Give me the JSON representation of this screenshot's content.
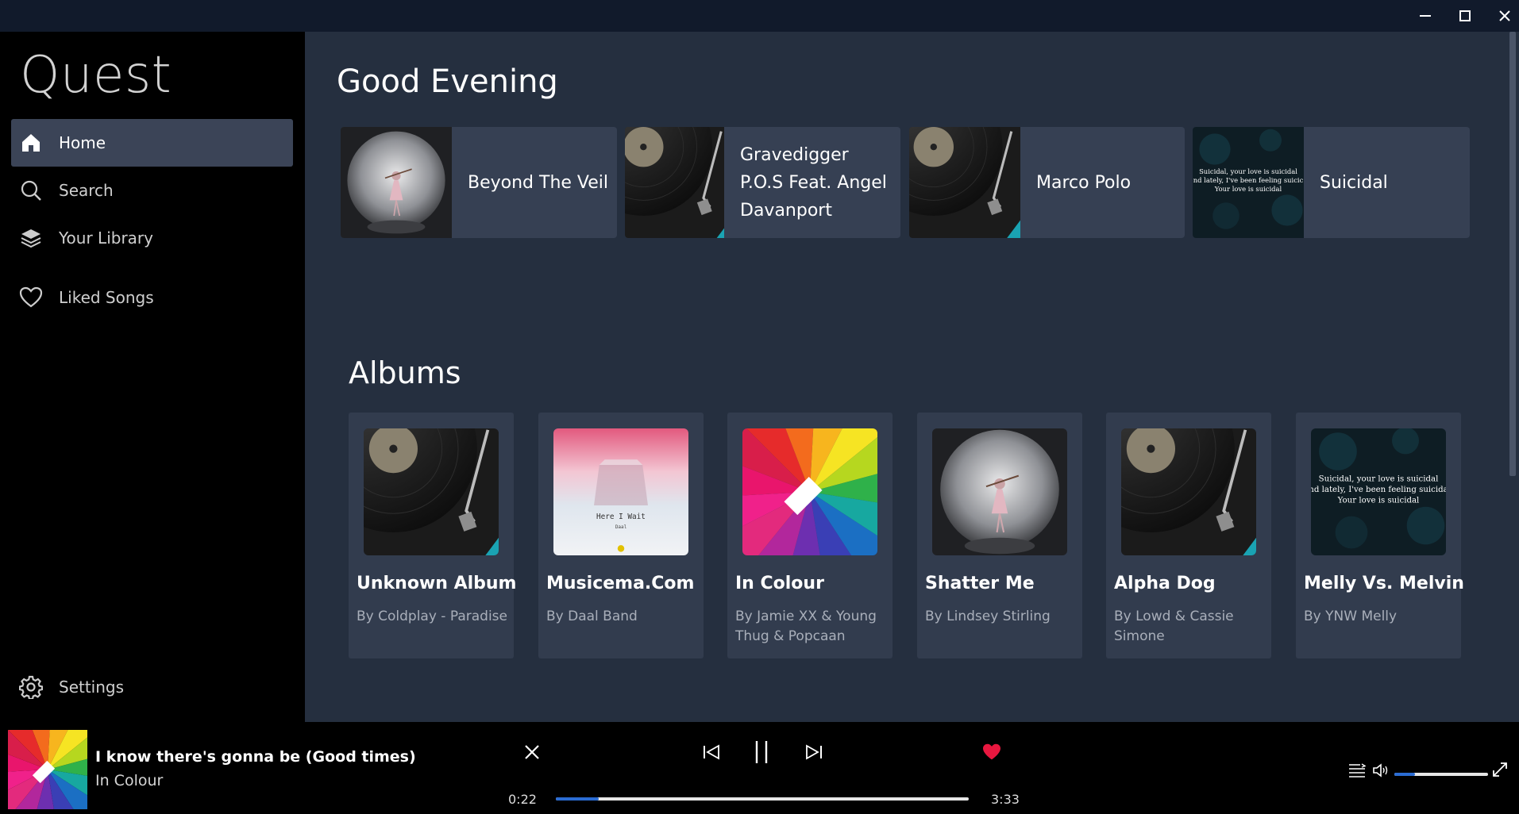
{
  "window": {
    "minimize_icon": "minimize-icon",
    "maximize_icon": "maximize-icon",
    "close_icon": "close-icon"
  },
  "sidebar": {
    "app_title": "Quest",
    "items": [
      {
        "label": "Home",
        "icon": "home-icon",
        "active": true
      },
      {
        "label": "Search",
        "icon": "search-icon",
        "active": false
      },
      {
        "label": "Your Library",
        "icon": "library-icon",
        "active": false
      },
      {
        "label": "Liked Songs",
        "icon": "heart-icon",
        "active": false
      }
    ],
    "settings": {
      "label": "Settings",
      "icon": "gear-icon"
    }
  },
  "main": {
    "greeting": "Good Evening",
    "quick_picks": [
      {
        "title": "Beyond The Veil",
        "art": "snowglobe"
      },
      {
        "title": "Gravedigger P.O.S Feat. Angel Davanport",
        "art": "vinyl"
      },
      {
        "title": "Marco Polo",
        "art": "vinyl"
      },
      {
        "title": "Suicidal",
        "art": "lyrics",
        "art_text": [
          "Suicidal, your love is suicidal",
          "nd lately, I've been feeling suicic",
          "Your love is suicidal"
        ]
      }
    ],
    "albums_title": "Albums",
    "albums": [
      {
        "name": "Unknown Album",
        "artist": "By Coldplay - Paradise",
        "art": "vinyl"
      },
      {
        "name": "Musicema.Com",
        "artist": "By Daal Band",
        "art": "pastel",
        "art_text": [
          "Here I Wait",
          "Daal"
        ]
      },
      {
        "name": "In Colour",
        "artist": "By Jamie XX & Young Thug & Popcaan",
        "art": "spectrum"
      },
      {
        "name": "Shatter Me",
        "artist": "By Lindsey Stirling",
        "art": "snowglobe"
      },
      {
        "name": "Alpha Dog",
        "artist": "By Lowd & Cassie Simone",
        "art": "vinyl"
      },
      {
        "name": "Melly Vs. Melvin",
        "artist": "By YNW Melly",
        "art": "lyrics",
        "art_text": [
          "Suicidal, your love is suicidal",
          "nd lately, I've been feeling suicida",
          "Your love is suicidal"
        ]
      }
    ]
  },
  "player": {
    "track_title": "I know there's gonna be (Good times)",
    "track_album": "In Colour",
    "elapsed": "0:22",
    "duration": "3:33",
    "progress_fraction": 0.103,
    "volume_fraction": 0.22,
    "liked": true,
    "colors": {
      "accent": "#2b6cd3",
      "heart": "#e8173f"
    }
  }
}
